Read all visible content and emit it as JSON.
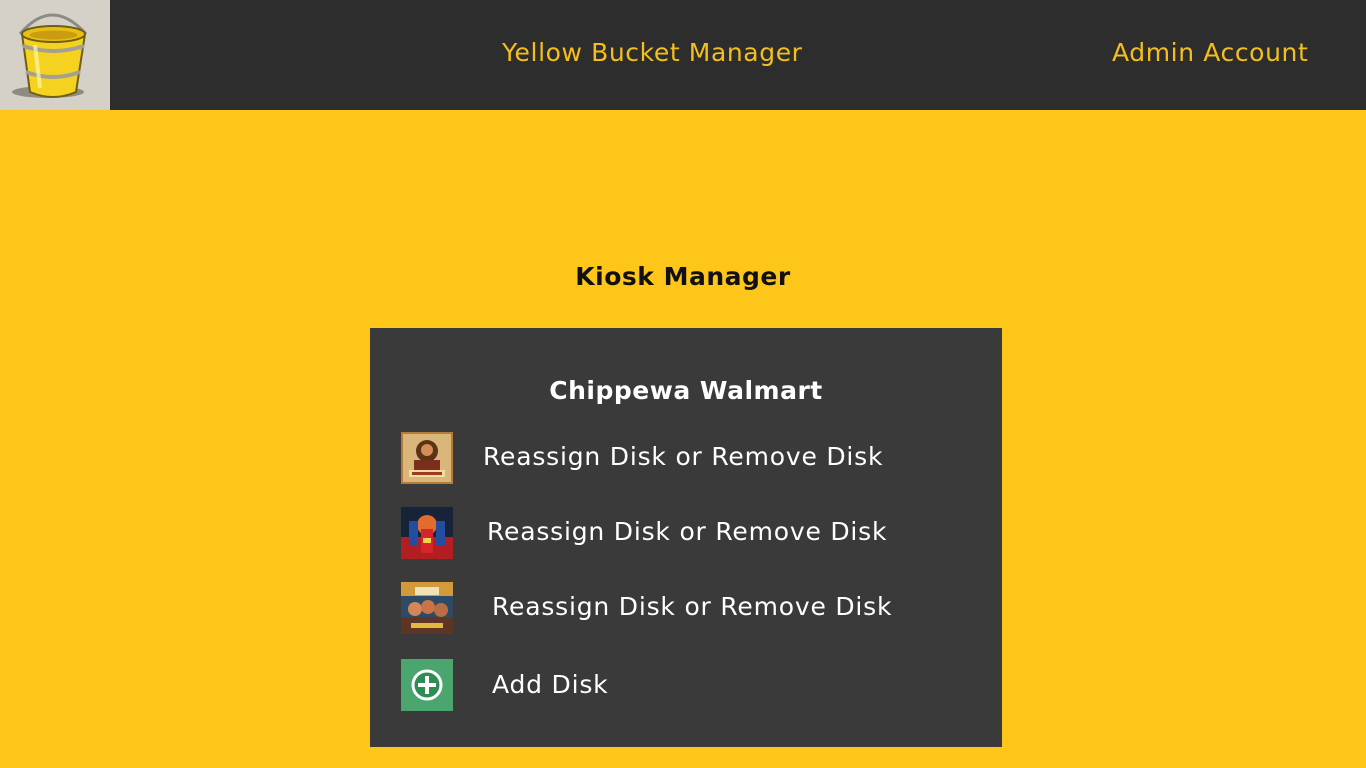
{
  "header": {
    "app_title": "Yellow Bucket Manager",
    "account_label": "Admin Account",
    "logo_icon": "yellow-bucket-icon"
  },
  "main": {
    "heading": "Kiosk Manager",
    "kiosk": {
      "name": "Chippewa Walmart",
      "disks": [
        {
          "thumbnail_icon": "movie-poster-thumbnail",
          "action_label": "Reassign Disk or Remove Disk"
        },
        {
          "thumbnail_icon": "movie-poster-thumbnail",
          "action_label": "Reassign Disk or Remove Disk"
        },
        {
          "thumbnail_icon": "movie-poster-thumbnail",
          "action_label": "Reassign Disk or Remove Disk"
        }
      ],
      "add_disk": {
        "icon": "plus-circle-icon",
        "label": "Add Disk"
      }
    }
  },
  "colors": {
    "page_background": "#FEC619",
    "header_background": "#2D2D2D",
    "header_text": "#F4BF1C",
    "panel_background": "#3A3A3A",
    "add_button": "#48A36B"
  }
}
